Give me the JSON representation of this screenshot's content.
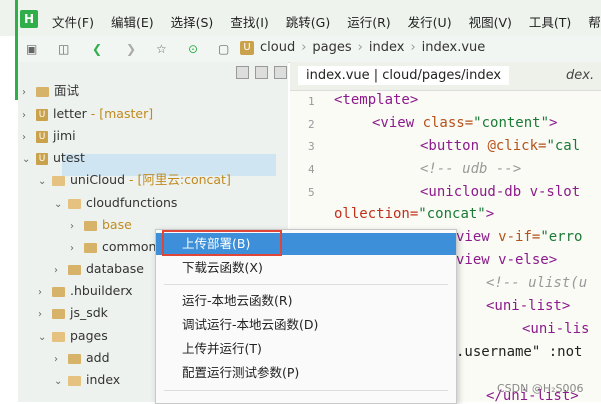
{
  "menubar": {
    "logo": "H",
    "items": [
      "文件(F)",
      "编辑(E)",
      "选择(S)",
      "查找(I)",
      "跳转(G)",
      "运行(R)",
      "发行(U)",
      "视图(V)",
      "工具(T)",
      "帮助(Y)"
    ]
  },
  "breadcrumb": {
    "root_icon": "U",
    "parts": [
      "cloud",
      "pages",
      "index",
      "index.vue"
    ]
  },
  "tree": [
    {
      "label": "面试",
      "extra": ""
    },
    {
      "label": "letter",
      "extra": " - [master]"
    },
    {
      "label": "jimi",
      "extra": ""
    },
    {
      "label": "utest",
      "extra": ""
    },
    {
      "label": "uniCloud",
      "extra": " - [阿里云:concat]"
    },
    {
      "label": "cloudfunctions",
      "extra": ""
    },
    {
      "label": "base",
      "extra": ""
    },
    {
      "label": "common",
      "extra": ""
    },
    {
      "label": "database",
      "extra": ""
    },
    {
      "label": ".hbuilderx",
      "extra": ""
    },
    {
      "label": "js_sdk",
      "extra": ""
    },
    {
      "label": "pages",
      "extra": ""
    },
    {
      "label": "add",
      "extra": ""
    },
    {
      "label": "index",
      "extra": ""
    }
  ],
  "editor": {
    "tab_active": "index.vue | cloud/pages/index",
    "tab_other": "dex.",
    "line_numbers": [
      "1",
      "2",
      "3",
      "4",
      "5"
    ],
    "lines": {
      "l1": "<template>",
      "l2_tag": "<view ",
      "l2_attr": "class=",
      "l2_str": "\"content\"",
      "l2_end": ">",
      "l3_tag": "<button ",
      "l3_attr": "@click=",
      "l3_str": "\"cal",
      "l4": "<!-- udb -->",
      "l5": "<unicloud-db v-slot",
      "l6_attr": "ollection=",
      "l6_str": "\"concat\"",
      "l6_end": ">",
      "l7_tag": "view ",
      "l7_attr": "v-if=",
      "l7_str": "\"erro",
      "l8": "view v-else>",
      "l9": "<!-- ulist(u",
      "l10": "<uni-list>",
      "l11": "<uni-lis",
      "l12": ".username\" :not",
      "l13": "</uni-list>"
    }
  },
  "context_menu": {
    "items": [
      "上传部署(B)",
      "下载云函数(X)",
      "运行-本地云函数(R)",
      "调试运行-本地云函数(D)",
      "上传并运行(T)",
      "配置运行测试参数(P)"
    ]
  },
  "watermark": "CSDN @H₂S006",
  "colors": {
    "accent": "#2fae4a",
    "menu_highlight": "#3c8fd8",
    "red_box": "#e0453a"
  }
}
